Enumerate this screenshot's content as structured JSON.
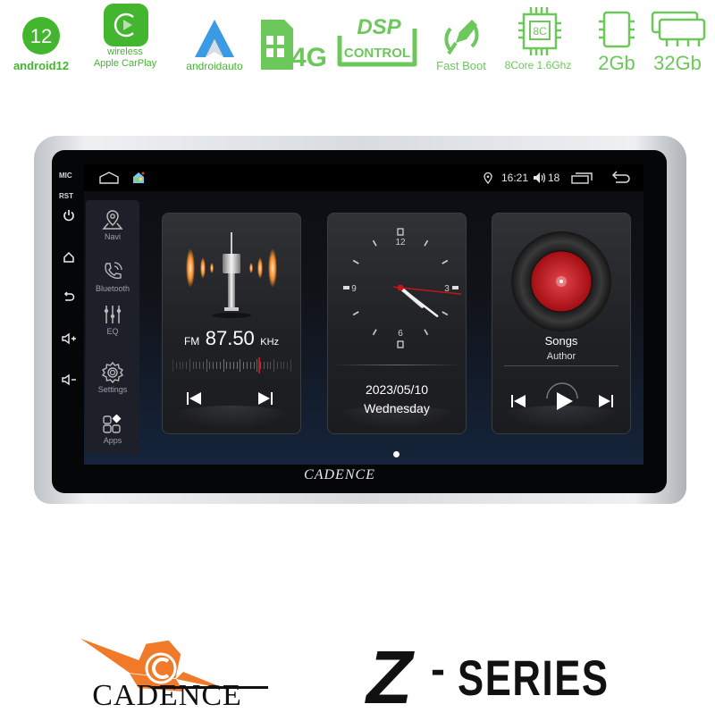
{
  "badges": [
    {
      "icon": "android12-icon",
      "label": "android12",
      "glyph": "12"
    },
    {
      "icon": "carplay-icon",
      "label_top": "wireless",
      "label": "Apple CarPlay"
    },
    {
      "icon": "android-auto-icon",
      "label": "androidauto"
    },
    {
      "icon": "sim-4g-icon",
      "label": "4G"
    },
    {
      "icon": "dsp-control-icon",
      "label_top": "DSP",
      "label": "CONTROL"
    },
    {
      "icon": "fast-boot-rocket-icon",
      "label": "Fast Boot"
    },
    {
      "icon": "cpu-chip-icon",
      "chip": "8C",
      "label": "8Core 1.6Ghz"
    },
    {
      "icon": "ram-chip-icon",
      "label": "2Gb"
    },
    {
      "icon": "storage-icon",
      "label": "32Gb"
    }
  ],
  "device": {
    "side_labels": {
      "mic": "MIC",
      "rst": "RST"
    },
    "side_buttons": [
      "power-icon",
      "home-icon",
      "back-icon",
      "volume-up-icon",
      "volume-down-icon"
    ],
    "bezel_brand": "CADENCE"
  },
  "statusbar": {
    "time": "16:21",
    "volume": "18",
    "icons": [
      "home-outline-icon",
      "launcher-icon",
      "location-icon",
      "volume-icon",
      "recent-apps-icon",
      "back-arrow-icon"
    ]
  },
  "dock": [
    {
      "label": "Navi",
      "icon": "navi-pin-icon"
    },
    {
      "label": "Bluetooth",
      "icon": "bluetooth-phone-icon"
    },
    {
      "label": "EQ",
      "icon": "equalizer-icon"
    },
    {
      "label": "Settings",
      "icon": "settings-gear-icon"
    },
    {
      "label": "Apps",
      "icon": "apps-grid-icon"
    }
  ],
  "radio": {
    "band": "FM",
    "frequency": "87.50",
    "unit": "KHz",
    "tuner_position": 0.73,
    "prev": "previous-station-icon",
    "next": "next-station-icon"
  },
  "clock": {
    "hour": 4,
    "minute": 21,
    "second": 16,
    "numerals": [
      "12",
      "3",
      "6",
      "9"
    ],
    "date": "2023/05/10",
    "weekday": "Wednesday"
  },
  "music": {
    "title": "Songs",
    "artist": "Author",
    "prev": "previous-track-icon",
    "play": "play-icon",
    "next": "next-track-icon"
  },
  "pager": {
    "pages": 1,
    "current": 1
  },
  "footer": {
    "brand": "CADENCE",
    "series_prefix": "Z",
    "series_sep": "-",
    "series": "SERIES"
  },
  "colors": {
    "badge_green": "#43b52f",
    "badge_light_green": "#6cc85a",
    "fm_orange": "#f08a2a",
    "accent_red": "#c4151c",
    "brand_orange": "#f07a2a"
  }
}
